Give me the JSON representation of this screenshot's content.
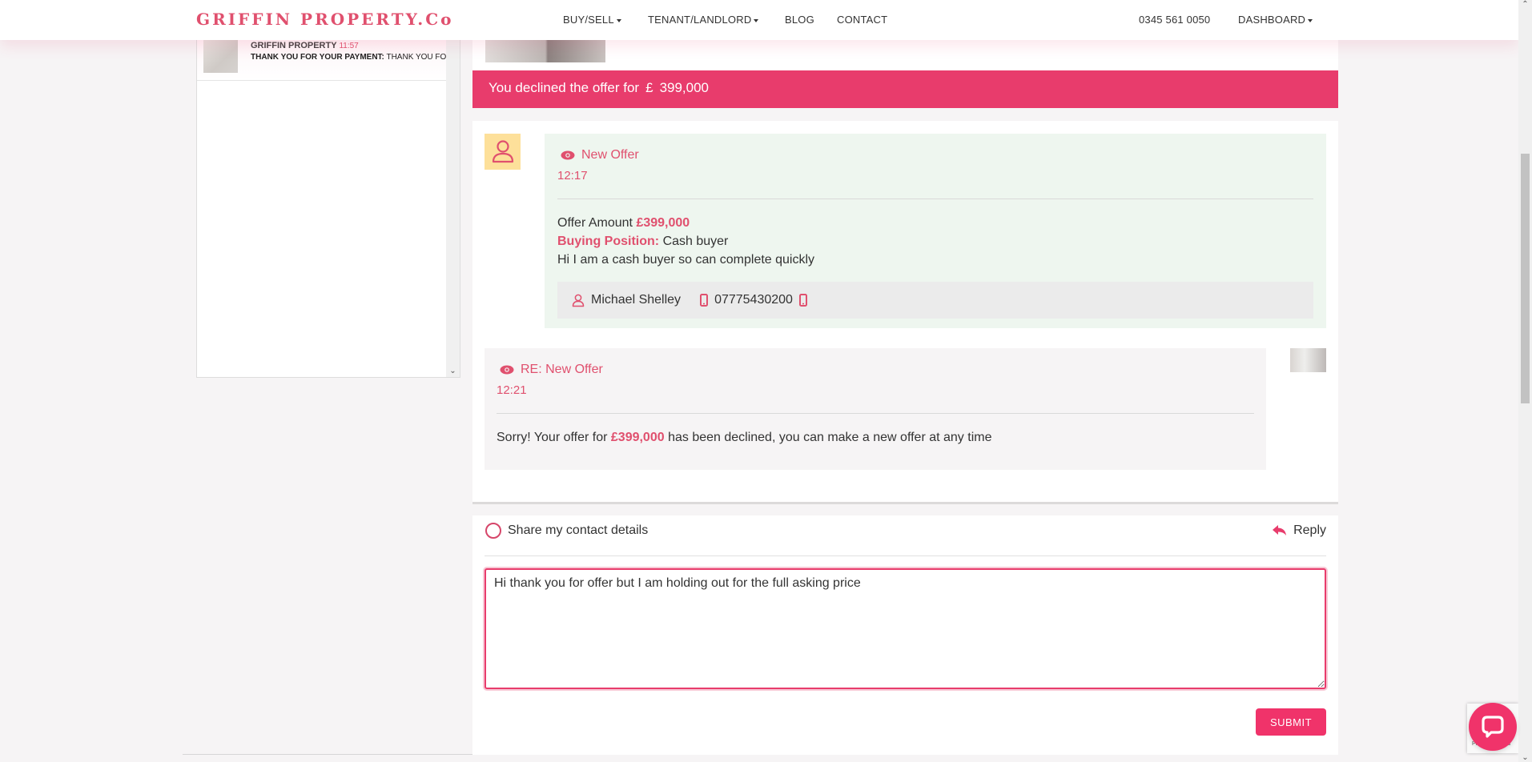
{
  "header": {
    "logo": "GRIFFIN PROPERTY.Co",
    "nav": [
      {
        "label": "BUY/SELL",
        "dropdown": true
      },
      {
        "label": "TENANT/LANDLORD",
        "dropdown": true
      },
      {
        "label": "BLOG",
        "dropdown": false
      },
      {
        "label": "CONTACT",
        "dropdown": false
      }
    ],
    "phone": "0345 561 0050",
    "dashboard_label": "DASHBOARD"
  },
  "conversations": [
    {
      "sender": "GRIFFIN PROPERTY",
      "time": "11:57",
      "subject": "THANK YOU FOR YOUR PAYMENT:",
      "preview": " THANK YOU FOR YOUR PAYMENT"
    }
  ],
  "banner": {
    "text": "You declined the offer for",
    "currency": "£",
    "amount": "399,000"
  },
  "messages": [
    {
      "icon": "eye-icon",
      "title": "New Offer",
      "time": "12:17",
      "offer_label": "Offer Amount",
      "offer_amount": "£399,000",
      "buying_position_label": "Buying Position:",
      "buying_position": "Cash buyer",
      "note": "Hi I am a cash buyer so can complete quickly",
      "contact": {
        "name": "Michael Shelley",
        "phone": "07775430200"
      }
    },
    {
      "icon": "eye-icon",
      "title": "RE: New Offer",
      "time": "12:21",
      "body_prefix": "Sorry! Your offer for ",
      "body_amount": "£399,000",
      "body_suffix": " has been declined, you can make a new offer at any time"
    }
  ],
  "compose": {
    "share_label": "Share my contact details",
    "share_checked": false,
    "reply_label": "Reply",
    "message_value": "Hi thank you for offer but I am holding out for the full asking price",
    "submit_label": "SUBMIT"
  },
  "widgets": {
    "recaptcha_text": "Privacy - Terms",
    "chat_icon": "chat-bubble-icon"
  },
  "colors": {
    "brand_pink": "#e83c6c",
    "logo_pink": "#e0506e",
    "offer_card_bg": "#eef6ef",
    "avatar_bg": "#fde09a"
  }
}
